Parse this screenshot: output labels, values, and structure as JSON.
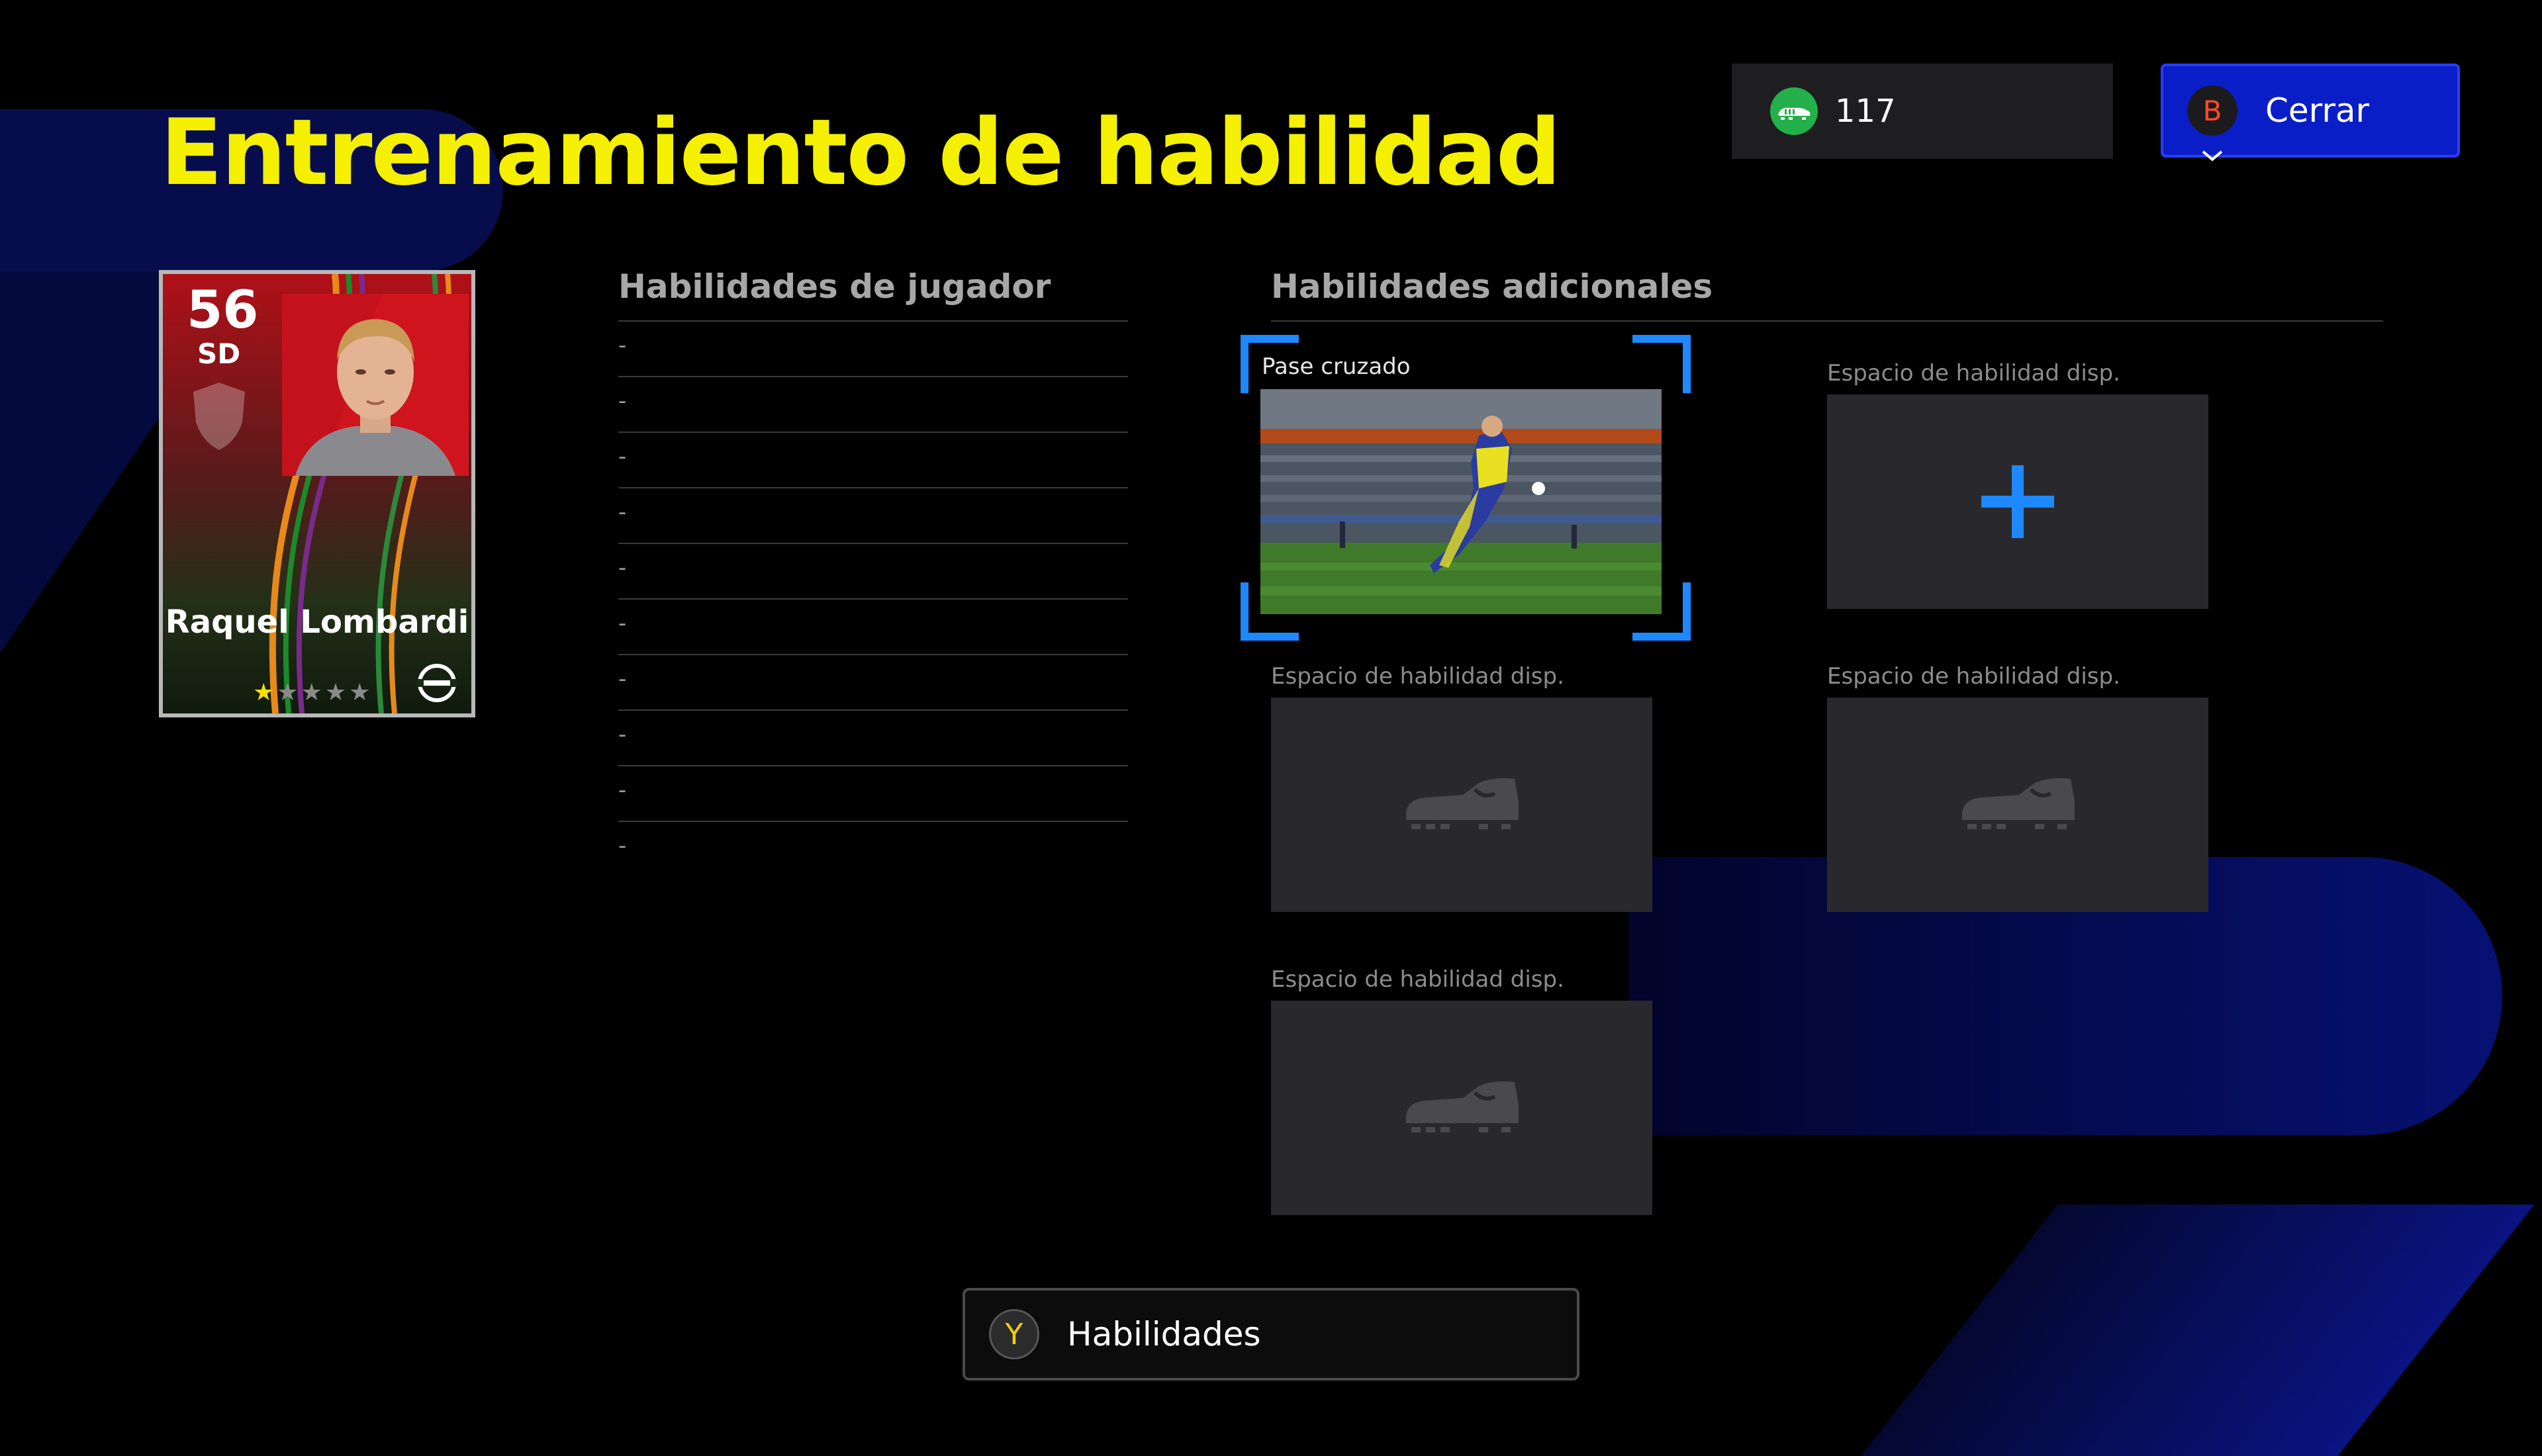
{
  "header": {
    "title": "Entrenamiento de habilidad"
  },
  "currency": {
    "icon": "skill-training-point-icon",
    "count": "117"
  },
  "close_button": {
    "key": "B",
    "label": "Cerrar"
  },
  "player_card": {
    "rating": "56",
    "position": "SD",
    "name": "Raquel Lombardi",
    "stars_filled": 1,
    "stars_total": 5,
    "accent_color": "#c8101e"
  },
  "player_skills": {
    "header": "Habilidades de jugador",
    "rows": [
      "-",
      "-",
      "-",
      "-",
      "-",
      "-",
      "-",
      "-",
      "-",
      "-"
    ]
  },
  "additional_skills": {
    "header": "Habilidades adicionales",
    "selected": {
      "label": "Pase cruzado"
    },
    "empty_label": "Espacio de habilidad disp.",
    "slots": [
      {
        "label": "Espacio de habilidad disp.",
        "icon": "plus-icon"
      },
      {
        "label": "Espacio de habilidad disp.",
        "icon": "boot-icon"
      },
      {
        "label": "Espacio de habilidad disp.",
        "icon": "boot-icon"
      },
      {
        "label": "Espacio de habilidad disp.",
        "icon": "boot-icon"
      }
    ]
  },
  "skills_button": {
    "key": "Y",
    "label": "Habilidades"
  },
  "colors": {
    "title": "#f4f000",
    "accent_blue": "#1e88ff",
    "close_button": "#0a1ec8"
  }
}
